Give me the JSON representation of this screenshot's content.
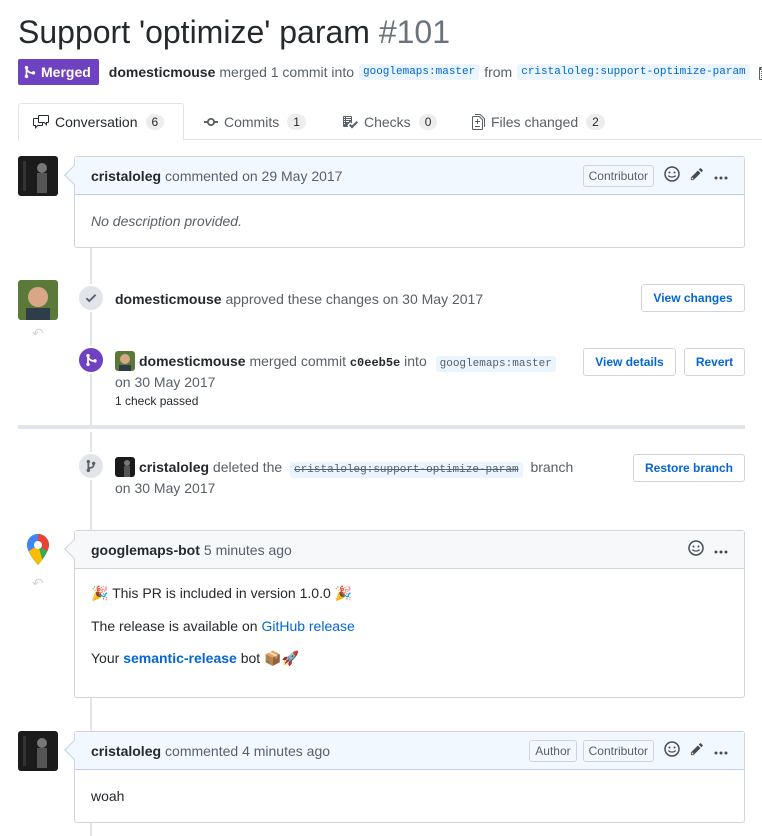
{
  "pr": {
    "title": "Support 'optimize' param",
    "number": "#101",
    "state": "Merged",
    "author": "domesticmouse",
    "merge_text": "merged 1 commit into",
    "base_branch": "googlemaps:master",
    "from_text": "from",
    "head_branch": "cristaloleg:support-optimize-param"
  },
  "tabs": [
    {
      "label": "Conversation",
      "count": "6"
    },
    {
      "label": "Commits",
      "count": "1"
    },
    {
      "label": "Checks",
      "count": "0"
    },
    {
      "label": "Files changed",
      "count": "2"
    }
  ],
  "comment1": {
    "author": "cristaloleg",
    "meta": "commented on 29 May 2017",
    "label": "Contributor",
    "body": "No description provided."
  },
  "review": {
    "author": "domesticmouse",
    "text": "approved these changes on 30 May 2017",
    "button": "View changes"
  },
  "merge_event": {
    "author": "domesticmouse",
    "text1": "merged commit",
    "commit": "c0eeb5e",
    "text2": "into",
    "branch": "googlemaps:master",
    "date": "on 30 May 2017",
    "checks": "1 check passed",
    "view_details": "View details",
    "revert": "Revert"
  },
  "delete_event": {
    "author": "cristaloleg",
    "text1": "deleted the",
    "branch": "cristaloleg:support-optimize-param",
    "text2": "branch",
    "date": "on 30 May 2017",
    "button": "Restore branch"
  },
  "bot_comment": {
    "author": "googlemaps-bot",
    "meta": "5 minutes ago",
    "line1_emoji_a": "🎉",
    "line1": "This PR is included in version 1.0.0",
    "line1_emoji_b": "🎉",
    "line2_prefix": "The release is available on",
    "line2_link": "GitHub release",
    "line3_prefix": "Your",
    "line3_link": "semantic-release",
    "line3_suffix": "bot",
    "line3_emoji": "📦🚀"
  },
  "comment2": {
    "author": "cristaloleg",
    "meta": "commented 4 minutes ago",
    "label_author": "Author",
    "label_contrib": "Contributor",
    "body": "woah"
  },
  "colors": {
    "merged": "#6f42c1",
    "link": "#0366d6",
    "header_blue": "#f1f8ff"
  }
}
